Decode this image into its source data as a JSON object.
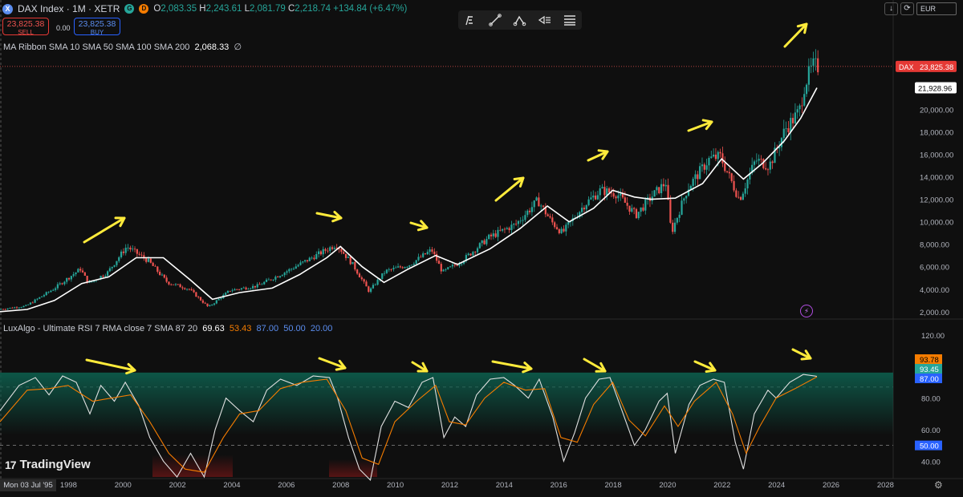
{
  "header": {
    "symbol_icon": "X",
    "title": "DAX Index · 1M · XETR",
    "badge_g": "G",
    "badge_d": "D",
    "ohlc": {
      "o_label": "O",
      "o": "2,083.35",
      "h_label": "H",
      "h": "2,243.61",
      "l_label": "L",
      "l": "2,081.79",
      "c_label": "C",
      "c": "2,218.74",
      "change": "+134.84 (+6.47%)"
    }
  },
  "trade": {
    "sell_price": "23,825.38",
    "sell_label": "SELL",
    "buy_price": "23,825.38",
    "buy_label": "BUY",
    "spread": "0.00"
  },
  "ma_legend": {
    "label": "MA Ribbon SMA 10 SMA 50 SMA 100 SMA 200",
    "value": "2,068.33",
    "icon": "∅"
  },
  "rsi_legend": {
    "label": "LuxAlgo - Ultimate RSI 7 RMA close 7 SMA 87 20",
    "v1": "69.63",
    "v2": "53.43",
    "v3": "87.00",
    "v4": "50.00",
    "v5": "20.00"
  },
  "right_controls": {
    "down_icon": "↓",
    "refresh_icon": "⟳",
    "currency": "EUR"
  },
  "branding": {
    "logo_mark": "17",
    "logo_text": "TradingView"
  },
  "cursor_date": "Mon 03 Jul '95",
  "colors": {
    "bg": "#0f0f0f",
    "up": "#26a69a",
    "down": "#ef5350",
    "ma": "#ffffff",
    "rsi": "#e0e0e0",
    "signal": "#f57c00",
    "arrow": "#ffeb3b",
    "teal_fill": "#0d5a4a",
    "red_fill": "#5a1414"
  },
  "chart_data": [
    {
      "type": "candlestick",
      "title": "DAX Index · 1M · XETR",
      "x_range": [
        1995.5,
        2028.3
      ],
      "x_ticks": [
        "1998",
        "2000",
        "2002",
        "2004",
        "2006",
        "2008",
        "2010",
        "2012",
        "2014",
        "2016",
        "2018",
        "2020",
        "2022",
        "2024",
        "2026",
        "2028"
      ],
      "y_ticks": [
        "2,000.00",
        "4,000.00",
        "6,000.00",
        "8,000.00",
        "10,000.00",
        "12,000.00",
        "14,000.00",
        "16,000.00",
        "18,000.00",
        "20,000.00"
      ],
      "y_range": [
        1200,
        25600
      ],
      "last_price_label": "DAX",
      "last_price": "23,825.38",
      "ma_label_value": "21,928.96",
      "price_path": [
        [
          1995.5,
          2200
        ],
        [
          1996.5,
          2500
        ],
        [
          1997.5,
          4000
        ],
        [
          1998.5,
          5800
        ],
        [
          1998.8,
          4500
        ],
        [
          1999.5,
          5500
        ],
        [
          2000.2,
          7800
        ],
        [
          2001.0,
          6500
        ],
        [
          2001.7,
          4600
        ],
        [
          2002.5,
          4000
        ],
        [
          2003.2,
          2400
        ],
        [
          2004.0,
          3900
        ],
        [
          2005.0,
          4300
        ],
        [
          2006.0,
          5500
        ],
        [
          2007.0,
          6800
        ],
        [
          2007.9,
          8000
        ],
        [
          2008.5,
          6200
        ],
        [
          2009.1,
          3800
        ],
        [
          2009.7,
          5600
        ],
        [
          2010.6,
          6200
        ],
        [
          2011.4,
          7500
        ],
        [
          2011.8,
          5500
        ],
        [
          2012.5,
          6500
        ],
        [
          2013.5,
          8600
        ],
        [
          2014.5,
          9800
        ],
        [
          2015.3,
          11900
        ],
        [
          2015.8,
          10000
        ],
        [
          2016.2,
          9000
        ],
        [
          2017.0,
          11500
        ],
        [
          2017.6,
          12800
        ],
        [
          2018.2,
          12500
        ],
        [
          2018.9,
          10600
        ],
        [
          2019.5,
          12300
        ],
        [
          2020.0,
          13500
        ],
        [
          2020.2,
          9000
        ],
        [
          2020.8,
          13000
        ],
        [
          2021.6,
          15600
        ],
        [
          2022.0,
          15800
        ],
        [
          2022.7,
          12000
        ],
        [
          2023.3,
          15500
        ],
        [
          2023.8,
          15000
        ],
        [
          2024.4,
          18300
        ],
        [
          2024.9,
          19800
        ],
        [
          2025.1,
          22300
        ],
        [
          2025.4,
          23825
        ]
      ],
      "ma_path": [
        [
          1995.5,
          2000
        ],
        [
          1996.5,
          2200
        ],
        [
          1997.5,
          3000
        ],
        [
          1998.5,
          4500
        ],
        [
          1999.5,
          5100
        ],
        [
          2000.5,
          6800
        ],
        [
          2001.5,
          6800
        ],
        [
          2002.5,
          4800
        ],
        [
          2003.3,
          3100
        ],
        [
          2004.3,
          3700
        ],
        [
          2005.5,
          4100
        ],
        [
          2006.5,
          5300
        ],
        [
          2007.5,
          6800
        ],
        [
          2008.0,
          7800
        ],
        [
          2008.8,
          6000
        ],
        [
          2009.6,
          4600
        ],
        [
          2010.5,
          5800
        ],
        [
          2011.5,
          7000
        ],
        [
          2012.3,
          6200
        ],
        [
          2013.5,
          7600
        ],
        [
          2014.6,
          9400
        ],
        [
          2015.6,
          11400
        ],
        [
          2016.4,
          10000
        ],
        [
          2017.3,
          11200
        ],
        [
          2018.0,
          12800
        ],
        [
          2018.8,
          12200
        ],
        [
          2019.4,
          12000
        ],
        [
          2020.3,
          12100
        ],
        [
          2021.3,
          13400
        ],
        [
          2022.0,
          15600
        ],
        [
          2022.8,
          13800
        ],
        [
          2023.5,
          15200
        ],
        [
          2024.3,
          17200
        ],
        [
          2024.9,
          19200
        ],
        [
          2025.5,
          21929
        ]
      ],
      "annotation": "arrows highlighting cycle tops"
    },
    {
      "type": "line",
      "title": "LuxAlgo - Ultimate RSI 7 RMA close 7 SMA 87 20",
      "y_ticks": [
        "120.00",
        "80.00",
        "60.00",
        "40.00"
      ],
      "y_range": [
        30,
        125
      ],
      "levels": [
        87,
        50
      ],
      "last_values": {
        "rsi": "93.78",
        "signal": "93.45",
        "ob_level": "87.00",
        "mid_level": "50.00"
      },
      "rsi_path": [
        [
          1995.5,
          72
        ],
        [
          1996.2,
          88
        ],
        [
          1996.8,
          93
        ],
        [
          1997.3,
          82
        ],
        [
          1997.8,
          94
        ],
        [
          1998.3,
          90
        ],
        [
          1998.8,
          70
        ],
        [
          1999.2,
          88
        ],
        [
          1999.7,
          78
        ],
        [
          2000.1,
          90
        ],
        [
          2000.6,
          75
        ],
        [
          2001.0,
          55
        ],
        [
          2001.5,
          40
        ],
        [
          2002.0,
          30
        ],
        [
          2002.5,
          45
        ],
        [
          2003.0,
          30
        ],
        [
          2003.4,
          60
        ],
        [
          2003.8,
          80
        ],
        [
          2004.3,
          72
        ],
        [
          2004.8,
          65
        ],
        [
          2005.3,
          85
        ],
        [
          2005.8,
          92
        ],
        [
          2006.4,
          88
        ],
        [
          2007.0,
          94
        ],
        [
          2007.6,
          93
        ],
        [
          2007.9,
          80
        ],
        [
          2008.3,
          55
        ],
        [
          2008.7,
          35
        ],
        [
          2009.1,
          28
        ],
        [
          2009.5,
          62
        ],
        [
          2010.0,
          78
        ],
        [
          2010.5,
          74
        ],
        [
          2011.0,
          90
        ],
        [
          2011.4,
          93
        ],
        [
          2011.8,
          55
        ],
        [
          2012.2,
          68
        ],
        [
          2012.6,
          62
        ],
        [
          2013.0,
          82
        ],
        [
          2013.5,
          92
        ],
        [
          2014.0,
          93
        ],
        [
          2014.4,
          88
        ],
        [
          2014.9,
          80
        ],
        [
          2015.3,
          92
        ],
        [
          2015.8,
          68
        ],
        [
          2016.2,
          40
        ],
        [
          2016.6,
          58
        ],
        [
          2017.0,
          80
        ],
        [
          2017.5,
          92
        ],
        [
          2017.9,
          93
        ],
        [
          2018.3,
          74
        ],
        [
          2018.8,
          50
        ],
        [
          2019.2,
          60
        ],
        [
          2019.7,
          78
        ],
        [
          2020.0,
          83
        ],
        [
          2020.3,
          45
        ],
        [
          2020.8,
          76
        ],
        [
          2021.2,
          88
        ],
        [
          2021.7,
          92
        ],
        [
          2022.1,
          90
        ],
        [
          2022.5,
          52
        ],
        [
          2022.8,
          35
        ],
        [
          2023.2,
          70
        ],
        [
          2023.7,
          85
        ],
        [
          2024.0,
          80
        ],
        [
          2024.5,
          90
        ],
        [
          2025.0,
          95
        ],
        [
          2025.5,
          93.78
        ]
      ],
      "signal_path": [
        [
          1995.5,
          65
        ],
        [
          1996.5,
          85
        ],
        [
          1997.3,
          86
        ],
        [
          1998.0,
          88
        ],
        [
          1998.9,
          78
        ],
        [
          1999.6,
          80
        ],
        [
          2000.3,
          82
        ],
        [
          2001.0,
          65
        ],
        [
          2001.7,
          45
        ],
        [
          2002.3,
          35
        ],
        [
          2003.0,
          33
        ],
        [
          2003.7,
          55
        ],
        [
          2004.3,
          70
        ],
        [
          2005.0,
          72
        ],
        [
          2005.8,
          86
        ],
        [
          2006.6,
          90
        ],
        [
          2007.5,
          92
        ],
        [
          2008.2,
          72
        ],
        [
          2008.8,
          42
        ],
        [
          2009.4,
          38
        ],
        [
          2010.0,
          65
        ],
        [
          2010.8,
          78
        ],
        [
          2011.5,
          88
        ],
        [
          2012.0,
          65
        ],
        [
          2012.6,
          63
        ],
        [
          2013.3,
          80
        ],
        [
          2014.0,
          90
        ],
        [
          2014.8,
          85
        ],
        [
          2015.5,
          86
        ],
        [
          2016.1,
          55
        ],
        [
          2016.7,
          52
        ],
        [
          2017.3,
          76
        ],
        [
          2018.0,
          90
        ],
        [
          2018.6,
          66
        ],
        [
          2019.2,
          56
        ],
        [
          2019.9,
          75
        ],
        [
          2020.4,
          62
        ],
        [
          2021.0,
          78
        ],
        [
          2021.8,
          90
        ],
        [
          2022.4,
          70
        ],
        [
          2022.9,
          45
        ],
        [
          2023.4,
          62
        ],
        [
          2024.0,
          80
        ],
        [
          2024.7,
          86
        ],
        [
          2025.5,
          93.45
        ]
      ]
    }
  ]
}
